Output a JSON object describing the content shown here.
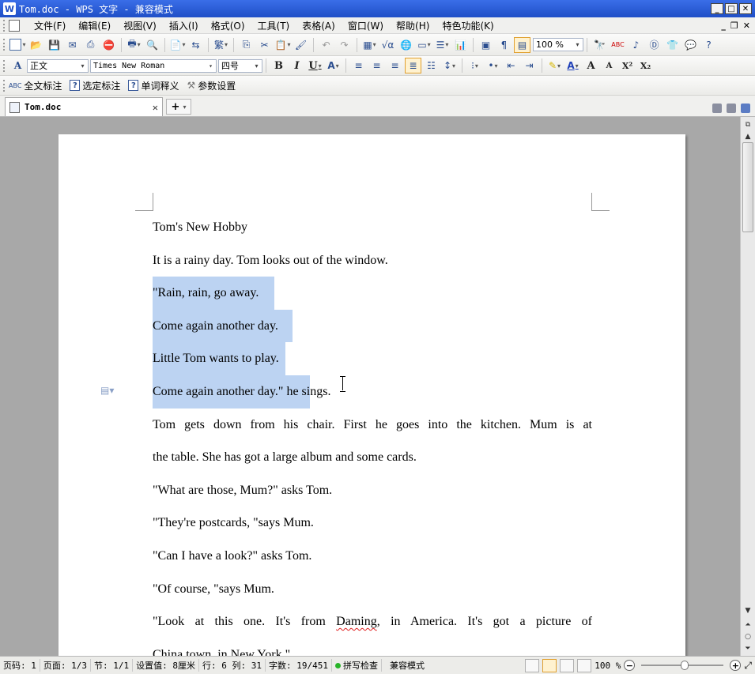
{
  "window": {
    "title": "Tom.doc - WPS 文字 - 兼容模式",
    "app_icon": "W"
  },
  "menu": {
    "items": [
      "文件(F)",
      "编辑(E)",
      "视图(V)",
      "插入(I)",
      "格式(O)",
      "工具(T)",
      "表格(A)",
      "窗口(W)",
      "帮助(H)",
      "特色功能(K)"
    ]
  },
  "toolbar": {
    "style": "正文",
    "font": "Times New Roman",
    "size": "四号",
    "zoom": "100 %",
    "format_buttons": {
      "bold": "B",
      "italic": "I",
      "underline": "U",
      "superscript": "X²",
      "subscript": "X₂",
      "grow": "A",
      "shrink": "A"
    }
  },
  "annotation_bar": {
    "full_text": "全文标注",
    "selected": "选定标注",
    "word_meaning": "单词释义",
    "settings": "参数设置"
  },
  "tabs": {
    "active": "Tom.doc",
    "new": "+"
  },
  "document": {
    "lines": [
      "Tom's New Hobby",
      "It is a rainy day. Tom looks out of the window.",
      "\"Rain, rain, go away.",
      "Come again another day.",
      "Little Tom wants to play.",
      "Come again another day.\" he si",
      "ngs.",
      "Tom gets down from his chair. First he goes into the kitchen. Mum is at",
      "the table. She has got a large album and some cards.",
      "\"What are those, Mum?\" asks Tom.",
      "\"They're postcards, \"says Mum.",
      "\"Can I have a look?\" asks Tom.",
      "\"Of course, \"says Mum.",
      "\"Look at this one. It's from ",
      "Daming",
      ", in America. It's got a picture of",
      "China town, in New York.\""
    ]
  },
  "status": {
    "page": "页码: 1",
    "pages": "页面: 1/3",
    "section": "节: 1/1",
    "setting": "设置值: 8厘米",
    "row_col": "行: 6 列: 31",
    "words": "字数: 19/451",
    "spell": "拼写检查",
    "compat": "兼容模式",
    "zoom": "100 %"
  },
  "colors": {
    "titlebar": "#2a5bd7",
    "selection": "#bcd3f2",
    "spell_ok": "#28b428"
  }
}
